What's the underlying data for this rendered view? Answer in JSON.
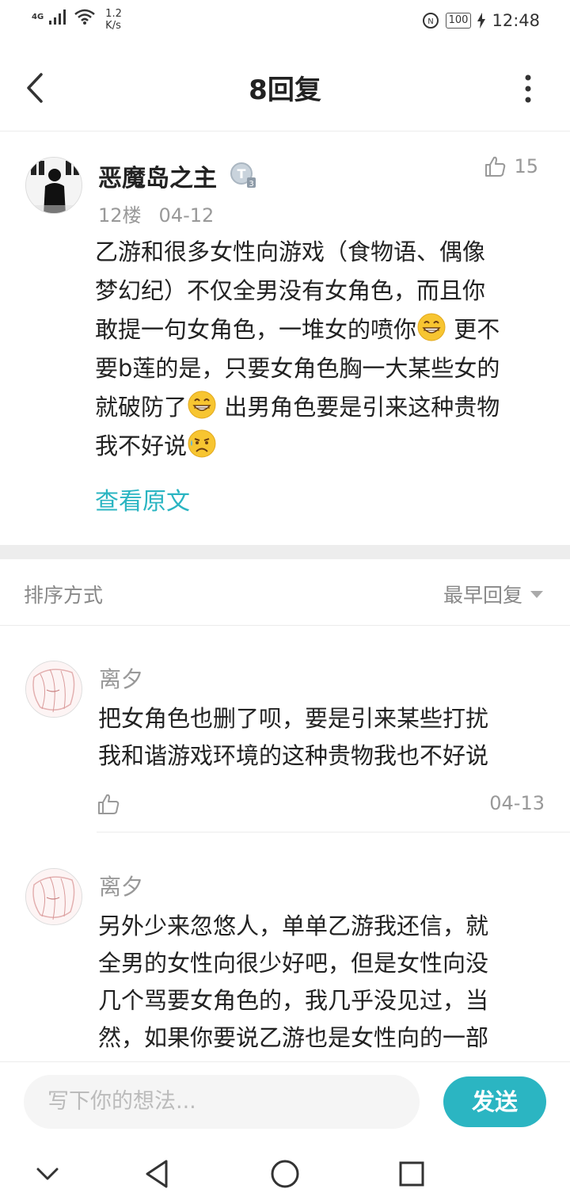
{
  "status_bar": {
    "network": "4G",
    "speed_value": "1.2",
    "speed_unit": "K/s",
    "battery": "100",
    "time": "12:48"
  },
  "header": {
    "title": "8回复"
  },
  "post": {
    "author": "恶魔岛之主",
    "like_count": "15",
    "floor": "12楼",
    "date": "04-12",
    "body": {
      "line1": "乙游和很多女性向游戏（食物语、偶像",
      "line2": "梦幻纪）不仅全男没有女角色，而且你",
      "line3a": "敢提一句女角色，一堆女的喷你",
      "line3b": " 更不",
      "line4": "要b莲的是，只要女角色胸一大某些女的",
      "line5a": "就破防了",
      "line5b": " 出男角色要是引来这种贵物",
      "line6": "我不好说"
    },
    "view_original": "查看原文"
  },
  "sort": {
    "label": "排序方式",
    "value": "最早回复"
  },
  "replies": [
    {
      "name": "离夕",
      "line1": "把女角色也删了呗，要是引来某些打扰",
      "line2": "我和谐游戏环境的这种贵物我也不好说",
      "date": "04-13"
    },
    {
      "name": "离夕",
      "line1": "另外少来忽悠人，单单乙游我还信，就",
      "line2": "全男的女性向很少好吧，但是女性向没",
      "line3": "几个骂要女角色的，我几乎没见过，当",
      "line4": "然，如果你要说乙游也是女性向的一部"
    }
  ],
  "input_bar": {
    "placeholder": "写下你的想法...",
    "send_label": "发送"
  },
  "colors": {
    "accent": "#2bb5c2",
    "divider": "#ececec",
    "muted_text": "#999999"
  },
  "icons": {
    "back": "chevron-left-icon",
    "more": "more-vertical-icon",
    "like": "thumbs-up-icon",
    "grin": "grinning-emoji-icon",
    "sad": "sad-sweat-emoji-icon"
  }
}
